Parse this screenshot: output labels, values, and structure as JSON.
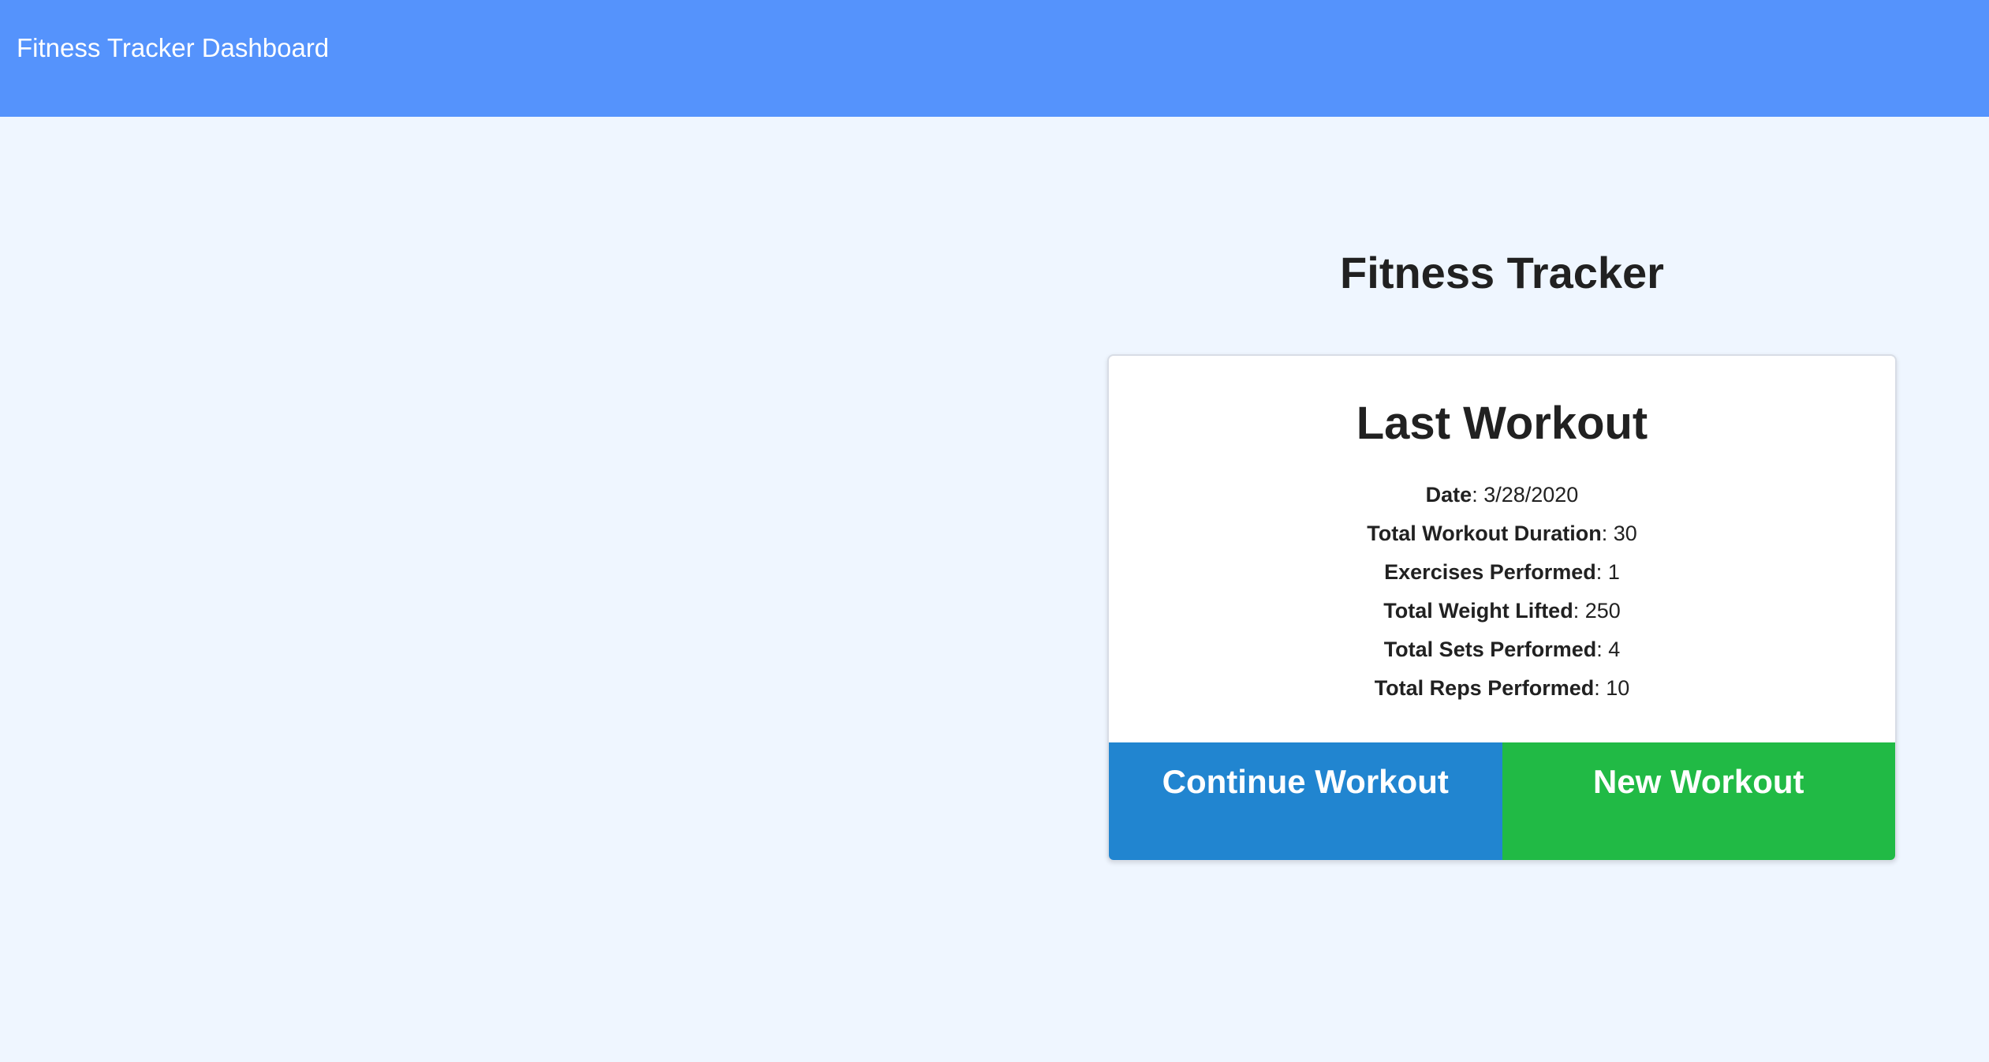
{
  "header": {
    "brand": "Fitness Tracker Dashboard"
  },
  "main": {
    "title": "Fitness Tracker",
    "card": {
      "title": "Last Workout",
      "stats": [
        {
          "label": "Date",
          "value": "3/28/2020"
        },
        {
          "label": "Total Workout Duration",
          "value": "30"
        },
        {
          "label": "Exercises Performed",
          "value": "1"
        },
        {
          "label": "Total Weight Lifted",
          "value": "250"
        },
        {
          "label": "Total Sets Performed",
          "value": "4"
        },
        {
          "label": "Total Reps Performed",
          "value": "10"
        }
      ],
      "continue_label": "Continue Workout",
      "new_label": "New Workout"
    }
  },
  "colors": {
    "header": "#5593fc",
    "background": "#eff6ff",
    "continue": "#2185d0",
    "new": "#21ba45"
  }
}
